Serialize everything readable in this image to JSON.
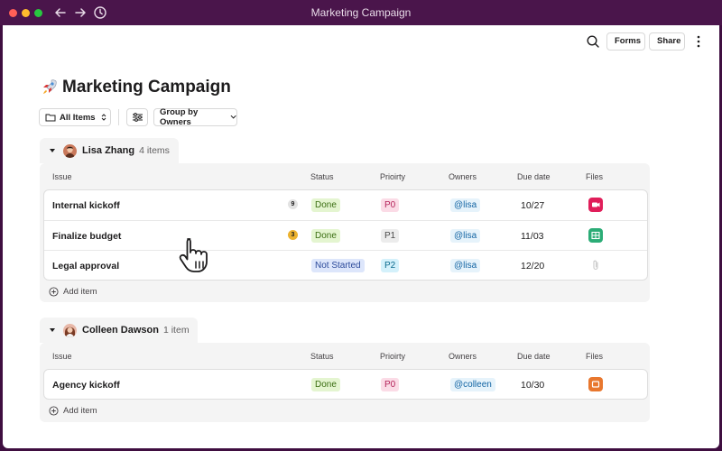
{
  "window": {
    "title": "Marketing Campaign"
  },
  "header": {
    "forms_label": "Forms",
    "share_label": "Share"
  },
  "page": {
    "title": "Marketing Campaign"
  },
  "toolbar": {
    "all_items_label": "All Items",
    "group_by_label": "Group by Owners"
  },
  "columns": {
    "issue": "Issue",
    "status": "Status",
    "priority": "Prioirty",
    "owners": "Owners",
    "due_date": "Due date",
    "files": "Files"
  },
  "groups": [
    {
      "name": "Lisa Zhang",
      "count_label": "4 items",
      "add_item_label": "Add item",
      "rows": [
        {
          "issue": "Internal kickoff",
          "badge": "9",
          "status": "Done",
          "priority": "P0",
          "owner": "@lisa",
          "due": "10/27",
          "file_icon": "video-file-icon"
        },
        {
          "issue": "Finalize budget",
          "badge": "3",
          "status": "Done",
          "priority": "P1",
          "owner": "@lisa",
          "due": "11/03",
          "file_icon": "spreadsheet-file-icon"
        },
        {
          "issue": "Legal approval",
          "badge": "",
          "status": "Not Started",
          "priority": "P2",
          "owner": "@lisa",
          "due": "12/20",
          "file_icon": "attachment-icon"
        }
      ]
    },
    {
      "name": "Colleen Dawson",
      "count_label": "1 item",
      "add_item_label": "Add item",
      "rows": [
        {
          "issue": "Agency kickoff",
          "badge": "",
          "status": "Done",
          "priority": "P0",
          "owner": "@colleen",
          "due": "10/30",
          "file_icon": "slides-file-icon"
        }
      ]
    }
  ],
  "colors": {
    "titlebar": "#4a154b",
    "done_bg": "#e4f5d0",
    "done_fg": "#3b6e12",
    "not_started_bg": "#dde6fb",
    "not_started_fg": "#2c4a9a",
    "p0_bg": "#fbdbe6",
    "p0_fg": "#b4235a",
    "p1_bg": "#ececec",
    "p1_fg": "#4a4a4a",
    "p2_bg": "#d4f1fb",
    "p2_fg": "#0b6a8d",
    "owner_bg": "#e6f3fb",
    "owner_fg": "#1264a3"
  }
}
